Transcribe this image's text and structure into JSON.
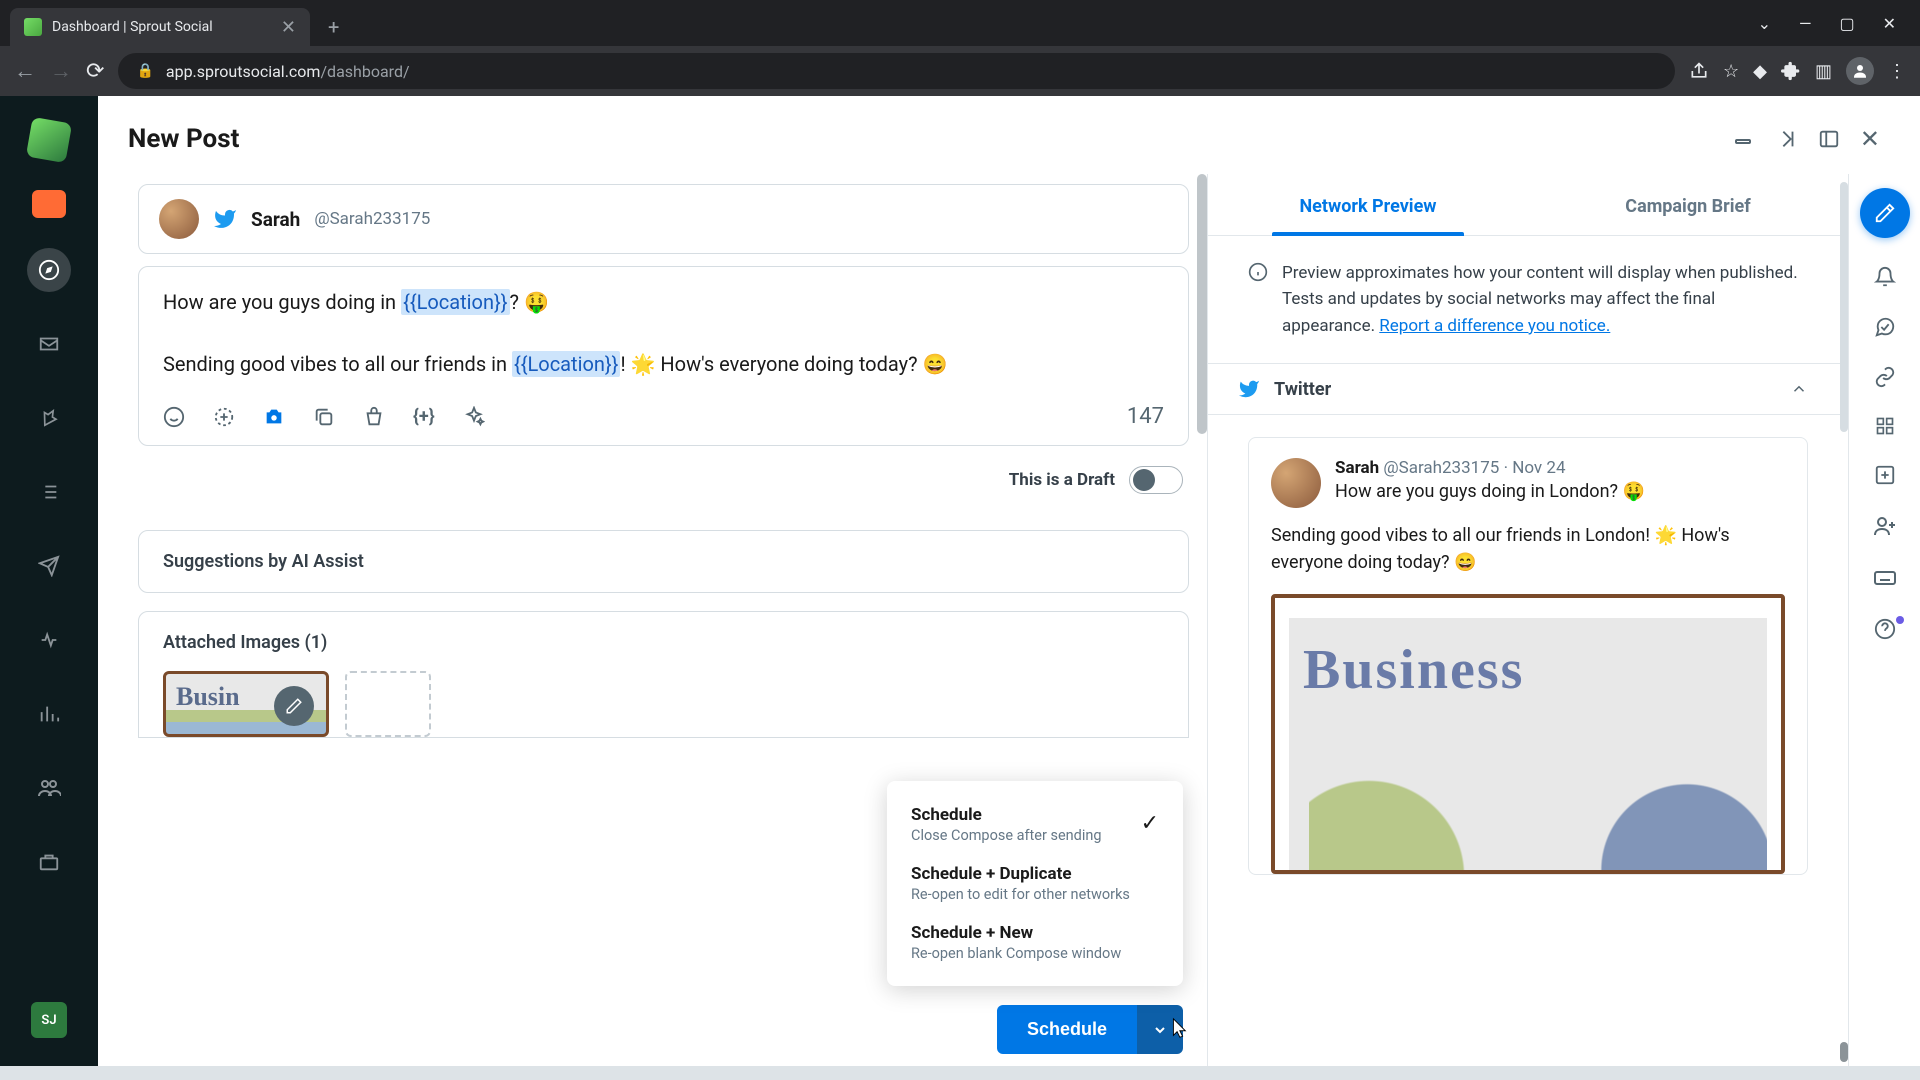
{
  "browser": {
    "tab_title": "Dashboard | Sprout Social",
    "url_host": "app.sproutsocial.com",
    "url_path": "/dashboard/"
  },
  "sidebar": {
    "avatar_initials": "SJ"
  },
  "header": {
    "page_title": "New Post"
  },
  "composer": {
    "profile": {
      "name": "Sarah",
      "handle": "@Sarah233175"
    },
    "text_parts": {
      "line1_pre": "How are you guys doing in ",
      "token": "{{Location}}",
      "line1_q": "? 🤑",
      "line2_pre": "Sending good vibes to all our friends in ",
      "line2_post": "! 🌟 How's everyone doing today? 😄"
    },
    "char_count": "147",
    "draft_label": "This is a Draft",
    "ai_section": "Suggestions by AI Assist",
    "attached_label": "Attached Images (1)",
    "thumb_word": "Busin",
    "schedule_btn": "Schedule"
  },
  "menu": {
    "opt1": {
      "title": "Schedule",
      "sub": "Close Compose after sending"
    },
    "opt2": {
      "title": "Schedule + Duplicate",
      "sub": "Re-open to edit for other networks"
    },
    "opt3": {
      "title": "Schedule + New",
      "sub": "Re-open blank Compose window"
    }
  },
  "preview": {
    "tab1": "Network Preview",
    "tab2": "Campaign Brief",
    "info_text": "Preview approximates how your content will display when published. Tests and updates by social networks may affect the final appearance. ",
    "info_link": "Report a difference you notice.",
    "network": "Twitter",
    "tweet": {
      "name": "Sarah",
      "handle": "@Sarah233175",
      "date": "Nov 24",
      "line1": "How are you guys doing in London? 🤑",
      "line2": "Sending good vibes to all our friends in London! 🌟 How's everyone doing today? 😄",
      "image_word": "Business"
    }
  }
}
